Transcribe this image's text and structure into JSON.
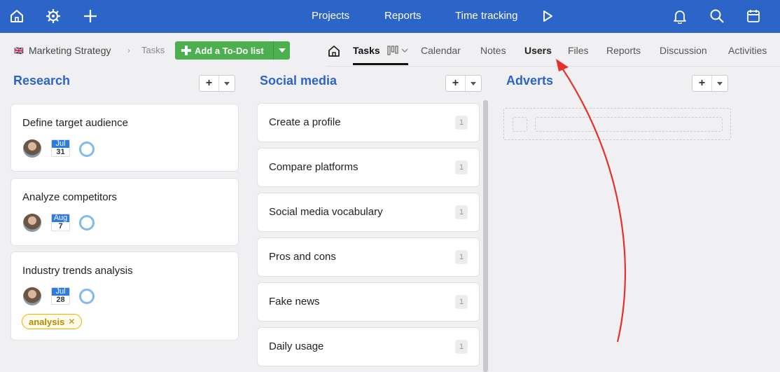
{
  "topbar": {
    "nav": [
      "Projects",
      "Reports",
      "Time tracking"
    ],
    "icons": [
      "home-icon",
      "settings-icon",
      "plus-icon",
      "play-icon",
      "bell-icon",
      "search-icon",
      "calendar-icon"
    ]
  },
  "breadcrumb": {
    "flag": "🇬🇧",
    "project": "Marketing Strategy",
    "section": "Tasks"
  },
  "add_button": {
    "label": "Add a To-Do list"
  },
  "tabs": [
    "Tasks",
    "Calendar",
    "Notes",
    "Users",
    "Files",
    "Reports",
    "Discussion",
    "Activities"
  ],
  "active_tab": "Tasks",
  "columns": {
    "research": {
      "title": "Research",
      "cards": [
        {
          "title": "Define target audience",
          "month": "Jul",
          "day": "31"
        },
        {
          "title": "Analyze competitors",
          "month": "Aug",
          "day": "7"
        },
        {
          "title": "Industry trends analysis",
          "month": "Jul",
          "day": "28",
          "tag": "analysis"
        }
      ]
    },
    "social": {
      "title": "Social media",
      "cards": [
        {
          "title": "Create a profile",
          "count": "1"
        },
        {
          "title": "Compare platforms",
          "count": "1"
        },
        {
          "title": "Social media vocabulary",
          "count": "1"
        },
        {
          "title": "Pros and cons",
          "count": "1"
        },
        {
          "title": "Fake news",
          "count": "1"
        },
        {
          "title": "Daily usage",
          "count": "1"
        }
      ]
    },
    "adverts": {
      "title": "Adverts"
    }
  },
  "colors": {
    "brand": "#2c64c8",
    "add_button": "#4caf50",
    "annotation_arrow": "#e8302a",
    "tag": "#e5b300"
  }
}
